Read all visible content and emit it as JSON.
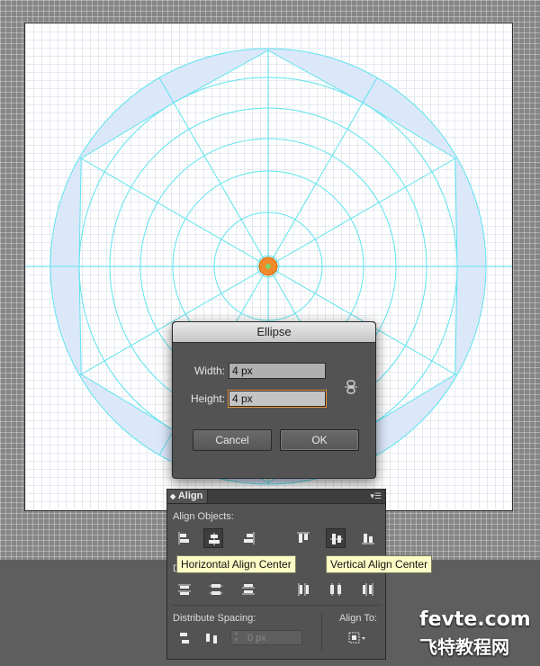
{
  "dialog": {
    "title": "Ellipse",
    "width_label": "Width:",
    "width_value": "4 px",
    "height_label": "Height:",
    "height_value": "4 px",
    "cancel_label": "Cancel",
    "ok_label": "OK"
  },
  "align_panel": {
    "tab_label": "Align",
    "align_objects_label": "Align Objects:",
    "distribute_spacing_label": "Distribute Spacing:",
    "align_to_label": "Align To:",
    "spacing_placeholder": "0 px"
  },
  "tooltips": {
    "horizontal": "Horizontal Align Center",
    "vertical": "Vertical Align Center"
  },
  "watermark": {
    "site": "fevte.com",
    "chinese": "飞特教程网"
  },
  "colors": {
    "guide": "#5fe3ef",
    "band_fill": "#dbe8fa",
    "center_dot": "#f08a2a",
    "accent_focus": "#e3963e"
  }
}
